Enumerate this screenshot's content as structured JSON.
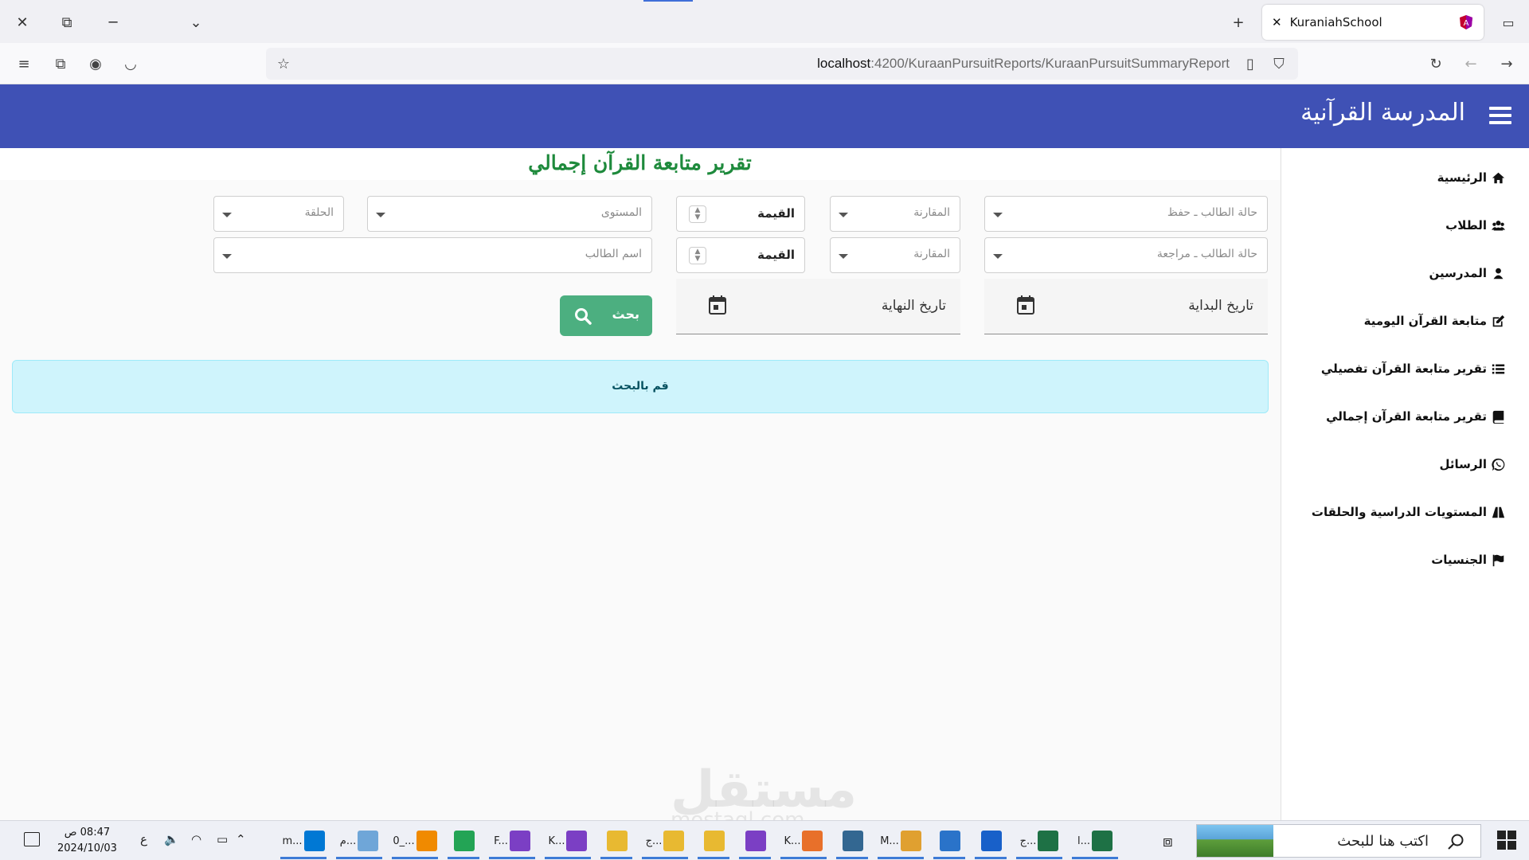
{
  "browser": {
    "tab_title": "KuraniahSchool",
    "url_host": "localhost",
    "url_path": ":4200/KuraanPursuitReports/KuraanPursuitSummaryReport"
  },
  "app": {
    "title": "المدرسة القرآنية",
    "accent": "#3f51b5"
  },
  "sidebar": {
    "items": [
      {
        "label": "الرئيسية",
        "icon": "home-icon"
      },
      {
        "label": "الطلاب",
        "icon": "users-icon"
      },
      {
        "label": "المدرسين",
        "icon": "user-icon"
      },
      {
        "label": "متابعة القرآن اليومية",
        "icon": "edit-icon"
      },
      {
        "label": "تقرير متابعة القرآن تفصيلي",
        "icon": "list-icon"
      },
      {
        "label": "تقرير متابعة القرآن إجمالي",
        "icon": "book-icon"
      },
      {
        "label": "الرسائل",
        "icon": "whatsapp-icon"
      },
      {
        "label": "المستويات الدراسية والحلقات",
        "icon": "road-icon"
      },
      {
        "label": "الجنسيات",
        "icon": "flag-icon"
      }
    ]
  },
  "page": {
    "title": "تقرير متابعة القرآن إجمالي",
    "title_color": "#1e8a3c"
  },
  "filters": {
    "status_hifz": "حالة الطالب ـ حفظ",
    "status_review": "حالة الطالب ـ مراجعة",
    "comparison_1": "المقارنة",
    "comparison_2": "المقارنة",
    "value_1": "القيمة",
    "value_2": "القيمة",
    "level": "المستوى",
    "circle": "الحلقة",
    "student_name": "اسم الطالب",
    "start_date": "تاريخ البداية",
    "end_date": "تاريخ النهاية",
    "search_label": "بحث"
  },
  "alert": {
    "message": "قم بالبحث"
  },
  "watermark": {
    "text": "مستقل",
    "sub": "mostaql.com"
  },
  "taskbar": {
    "search_placeholder": "اكتب هنا للبحث",
    "time": "08:47 ص",
    "date": "2024/10/03",
    "lang": "ع",
    "apps": [
      {
        "label": "ا...",
        "color": "#1e7145"
      },
      {
        "label": "ج...",
        "color": "#1e7145"
      },
      {
        "label": "",
        "color": "#1860c9"
      },
      {
        "label": "",
        "color": "#2a73c9"
      },
      {
        "label": "M...",
        "color": "#e0a030"
      },
      {
        "label": "",
        "color": "#336791"
      },
      {
        "label": "K...",
        "color": "#e8702a"
      },
      {
        "label": "",
        "color": "#7b3fc4"
      },
      {
        "label": "",
        "color": "#e8b931"
      },
      {
        "label": "ج...",
        "color": "#e8b931"
      },
      {
        "label": "",
        "color": "#e8b931"
      },
      {
        "label": "K...",
        "color": "#7b3fc4"
      },
      {
        "label": "F...",
        "color": "#7b3fc4"
      },
      {
        "label": "",
        "color": "#23a455"
      },
      {
        "label": "0_...",
        "color": "#f08a00"
      },
      {
        "label": "م...",
        "color": "#6fa6d8"
      },
      {
        "label": "m...",
        "color": "#0078d4"
      }
    ]
  }
}
